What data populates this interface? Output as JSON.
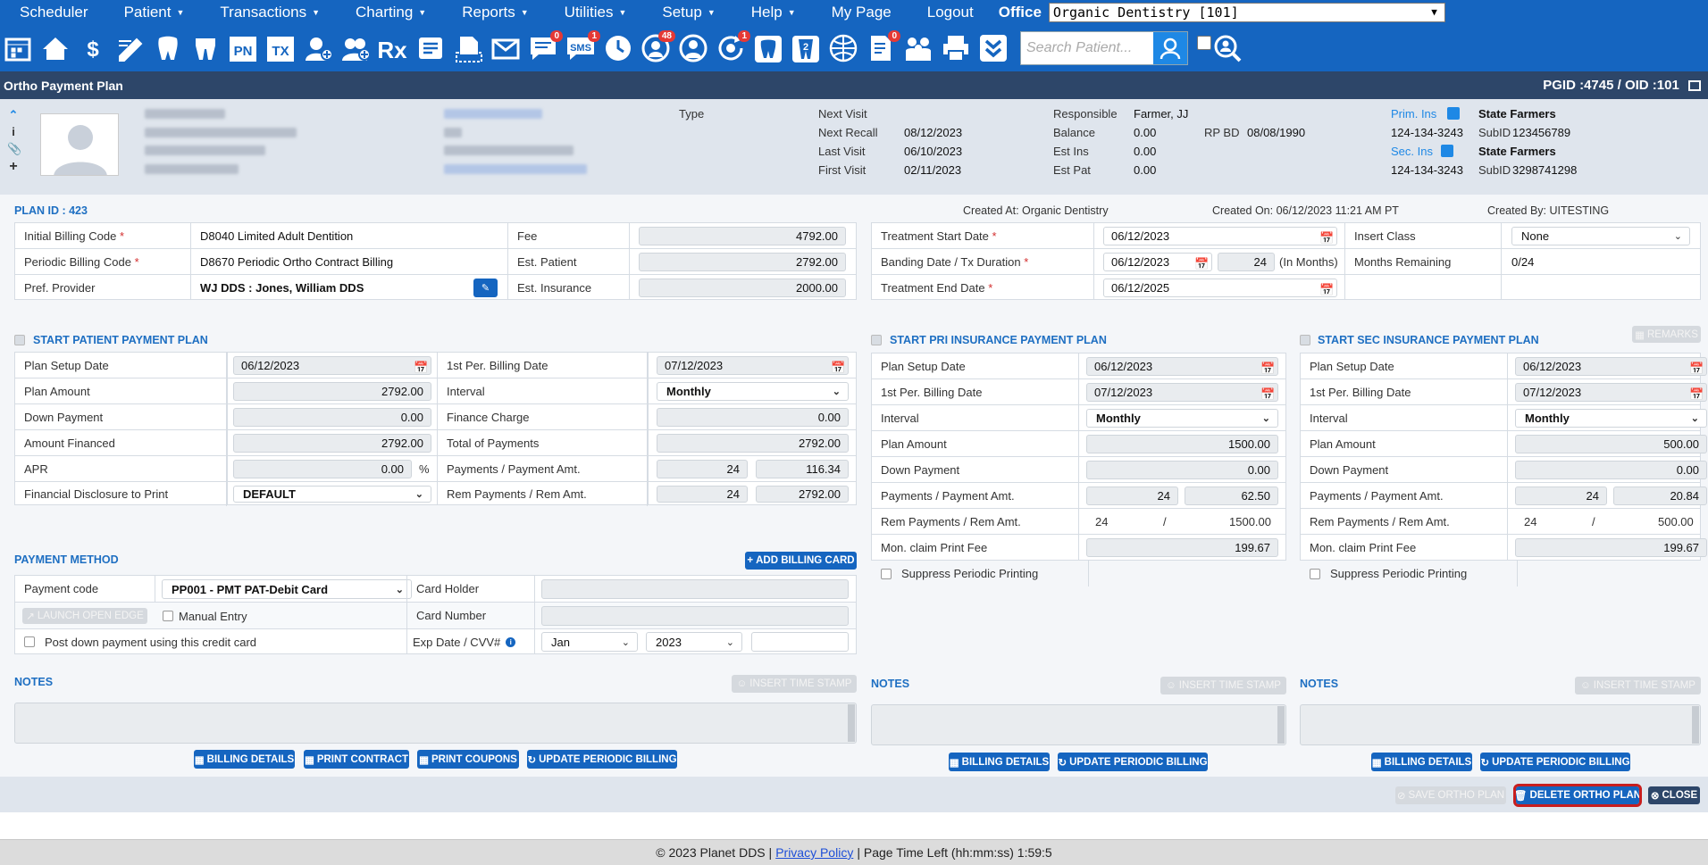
{
  "nav": {
    "items": [
      {
        "label": "Scheduler",
        "dropdown": false
      },
      {
        "label": "Patient",
        "dropdown": true
      },
      {
        "label": "Transactions",
        "dropdown": true
      },
      {
        "label": "Charting",
        "dropdown": true
      },
      {
        "label": "Reports",
        "dropdown": true
      },
      {
        "label": "Utilities",
        "dropdown": true
      },
      {
        "label": "Setup",
        "dropdown": true
      },
      {
        "label": "Help",
        "dropdown": true
      },
      {
        "label": "My Page",
        "dropdown": false
      },
      {
        "label": "Logout",
        "dropdown": false
      }
    ],
    "office_label": "Office",
    "office_value": "Organic Dentistry [101]"
  },
  "toolbar": {
    "icons": [
      "calendar-icon",
      "home-icon",
      "dollar-transfer-icon",
      "pencil-chart-icon",
      "tooth-icon",
      "molar-icon",
      "pn-icon",
      "tx-icon",
      "add-person-icon",
      "add-family-icon",
      "rx-icon",
      "notes-icon",
      "document-print-icon",
      "mail-icon",
      "message-icon",
      "sms-icon",
      "clock-icon",
      "patients-group-icon",
      "support-icon",
      "refresh-alert-icon",
      "tooth-card-icon",
      "tooth-2-icon",
      "globe-tooth-icon",
      "check-doc-icon",
      "family-icon",
      "printer-icon",
      "download-chevron-icon"
    ],
    "badges": {
      "message": "0",
      "sms": "1",
      "patients": "48",
      "refresh": "1",
      "checkdoc": "0"
    },
    "search_placeholder": "Search Patient..."
  },
  "title": {
    "text": "Ortho Payment Plan",
    "ids": "PGID :4745  /  OID :101"
  },
  "patient": {
    "type_label": "Type",
    "next_visit_label": "Next Visit",
    "next_visit": "",
    "next_recall_label": "Next Recall",
    "next_recall": "08/12/2023",
    "last_visit_label": "Last Visit",
    "last_visit": "06/10/2023",
    "first_visit_label": "First Visit",
    "first_visit": "02/11/2023",
    "responsible_label": "Responsible",
    "responsible": "Farmer, JJ",
    "balance_label": "Balance",
    "balance": "0.00",
    "rpbd_label": "RP BD",
    "rpbd": "08/08/1990",
    "est_ins_label": "Est Ins",
    "est_ins": "0.00",
    "est_pat_label": "Est Pat",
    "est_pat": "0.00",
    "prim_ins_label": "Prim. Ins",
    "prim_ins": "State Farmers",
    "prim_phone": "124-134-3243",
    "prim_subid_label": "SubID",
    "prim_subid": "123456789",
    "sec_ins_label": "Sec. Ins",
    "sec_ins": "State Farmers",
    "sec_phone": "124-134-3243",
    "sec_subid_label": "SubID",
    "sec_subid": "3298741298"
  },
  "plan": {
    "plan_id": "PLAN ID : 423",
    "created_at": "Created At: Organic Dentistry",
    "created_on": "Created On: 06/12/2023 11:21 AM PT",
    "created_by": "Created By: UITESTING",
    "initial_billing_label": "Initial Billing Code",
    "initial_billing": "D8040 Limited Adult Dentition",
    "periodic_billing_label": "Periodic Billing Code",
    "periodic_billing": "D8670 Periodic Ortho Contract Billing",
    "pref_provider_label": "Pref. Provider",
    "pref_provider": "WJ DDS : Jones, William DDS",
    "fee_label": "Fee",
    "fee": "4792.00",
    "est_patient_label": "Est. Patient",
    "est_patient": "2792.00",
    "est_insurance_label": "Est. Insurance",
    "est_insurance": "2000.00",
    "tx_start_label": "Treatment Start Date",
    "tx_start": "06/12/2023",
    "banding_label": "Banding Date / Tx Duration",
    "banding": "06/12/2023",
    "duration": "24",
    "duration_unit": "(In Months)",
    "tx_end_label": "Treatment End Date",
    "tx_end": "06/12/2025",
    "insert_class_label": "Insert Class",
    "insert_class": "None",
    "months_remaining_label": "Months Remaining",
    "months_remaining": "0/24"
  },
  "patient_plan": {
    "header": "START PATIENT PAYMENT PLAN",
    "setup_label": "Plan Setup Date",
    "setup": "06/12/2023",
    "plan_amount_label": "Plan Amount",
    "plan_amount": "2792.00",
    "down_label": "Down Payment",
    "down": "0.00",
    "financed_label": "Amount Financed",
    "financed": "2792.00",
    "apr_label": "APR",
    "apr": "0.00",
    "apr_unit": "%",
    "disclosure_label": "Financial Disclosure to Print",
    "disclosure": "DEFAULT",
    "first_billing_label": "1st Per. Billing Date",
    "first_billing": "07/12/2023",
    "interval_label": "Interval",
    "interval": "Monthly",
    "finance_charge_label": "Finance Charge",
    "finance_charge": "0.00",
    "total_payments_label": "Total of Payments",
    "total_payments": "2792.00",
    "payments_label": "Payments / Payment Amt.",
    "payments": "24",
    "payment_amt": "116.34",
    "rem_label": "Rem Payments / Rem Amt.",
    "rem_payments": "24",
    "rem_amt": "2792.00"
  },
  "payment_method": {
    "header": "PAYMENT METHOD",
    "add_card": "ADD BILLING CARD",
    "code_label": "Payment code",
    "code": "PP001 - PMT PAT-Debit Card",
    "launch_edge": "LAUNCH OPEN EDGE",
    "manual_entry": "Manual Entry",
    "post_down": "Post down payment using this credit card",
    "holder_label": "Card Holder",
    "number_label": "Card Number",
    "exp_label": "Exp Date / CVV#",
    "exp_month": "Jan",
    "exp_year": "2023"
  },
  "notes": {
    "label": "NOTES",
    "stamp": "INSERT TIME STAMP"
  },
  "buttons": {
    "billing_details": "BILLING DETAILS",
    "print_contract": "PRINT CONTRACT",
    "print_coupons": "PRINT COUPONS",
    "update_periodic": "UPDATE PERIODIC BILLING",
    "remarks": "REMARKS",
    "save": "SAVE ORTHO PLAN",
    "delete": "DELETE ORTHO PLAN",
    "close": "CLOSE"
  },
  "pri_plan": {
    "header": "START PRI INSURANCE PAYMENT PLAN",
    "setup_label": "Plan Setup Date",
    "setup": "06/12/2023",
    "first_billing_label": "1st Per. Billing Date",
    "first_billing": "07/12/2023",
    "interval_label": "Interval",
    "interval": "Monthly",
    "plan_amount_label": "Plan Amount",
    "plan_amount": "1500.00",
    "down_label": "Down Payment",
    "down": "0.00",
    "payments_label": "Payments / Payment Amt.",
    "payments": "24",
    "payment_amt": "62.50",
    "rem_label": "Rem Payments / Rem Amt.",
    "rem_payments": "24",
    "rem_sep": "/",
    "rem_amt": "1500.00",
    "claim_fee_label": "Mon. claim Print Fee",
    "claim_fee": "199.67",
    "suppress": "Suppress Periodic Printing"
  },
  "sec_plan": {
    "header": "START SEC INSURANCE PAYMENT PLAN",
    "setup_label": "Plan Setup Date",
    "setup": "06/12/2023",
    "first_billing_label": "1st Per. Billing Date",
    "first_billing": "07/12/2023",
    "interval_label": "Interval",
    "interval": "Monthly",
    "plan_amount_label": "Plan Amount",
    "plan_amount": "500.00",
    "down_label": "Down Payment",
    "down": "0.00",
    "payments_label": "Payments / Payment Amt.",
    "payments": "24",
    "payment_amt": "20.84",
    "rem_label": "Rem Payments / Rem Amt.",
    "rem_payments": "24",
    "rem_sep": "/",
    "rem_amt": "500.00",
    "claim_fee_label": "Mon. claim Print Fee",
    "claim_fee": "199.67",
    "suppress": "Suppress Periodic Printing"
  },
  "footer": {
    "copyright": "© 2023 Planet DDS |",
    "privacy": "Privacy Policy",
    "time_left": "|  Page Time Left (hh:mm:ss) 1:59:5"
  }
}
